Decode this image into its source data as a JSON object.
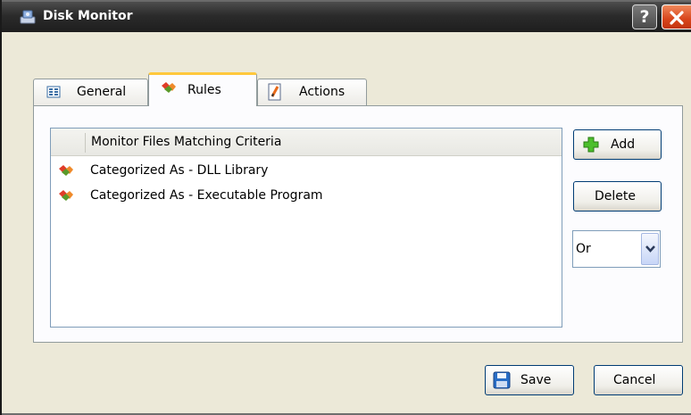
{
  "window": {
    "title": "Disk Monitor"
  },
  "titlebar": {
    "help_label": "?"
  },
  "tabs": [
    {
      "label": "General",
      "icon": "general-grid-icon",
      "active": false
    },
    {
      "label": "Rules",
      "icon": "rules-gem-icon",
      "active": true
    },
    {
      "label": "Actions",
      "icon": "actions-page-icon",
      "active": false
    }
  ],
  "rules_list": {
    "header": "Monitor Files Matching Criteria",
    "items": [
      {
        "label": "Categorized As - DLL Library",
        "icon": "rule-gem-icon"
      },
      {
        "label": "Categorized As - Executable Program",
        "icon": "rule-gem-icon"
      }
    ]
  },
  "side_buttons": {
    "add_label": "Add",
    "delete_label": "Delete"
  },
  "logic_select": {
    "value": "Or"
  },
  "footer": {
    "save_label": "Save",
    "cancel_label": "Cancel"
  },
  "colors": {
    "titlebar": "#2b2b2b",
    "close_button": "#d8451c",
    "active_tab_highlight": "#ffc83c",
    "dialog_background": "#ece9d8"
  }
}
